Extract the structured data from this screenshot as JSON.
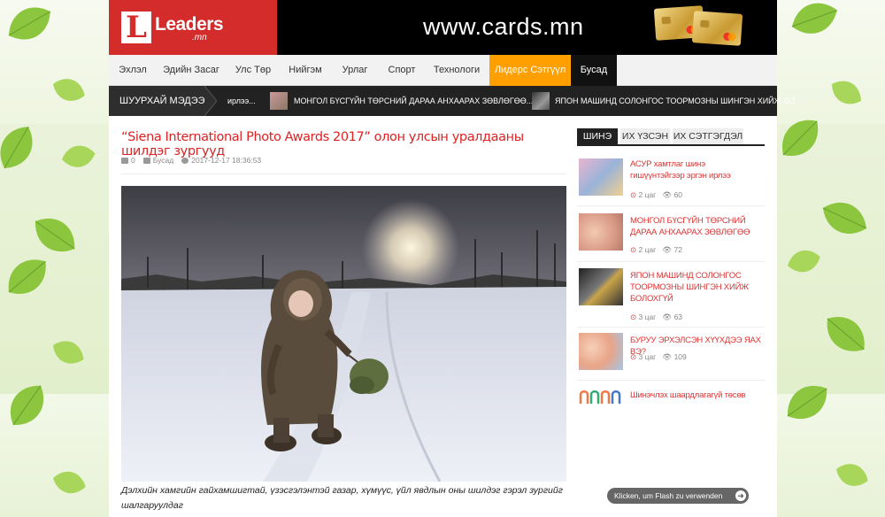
{
  "logo": {
    "mark": "L",
    "name": "Leaders",
    "sub": ".mn"
  },
  "banner": {
    "url": "www.cards.mn"
  },
  "nav": {
    "items": [
      {
        "label": "Эхлэл"
      },
      {
        "label": "Эдийн Засаг"
      },
      {
        "label": "Улс Төр"
      },
      {
        "label": "Нийгэм"
      },
      {
        "label": "Урлаг"
      },
      {
        "label": "Спорт"
      },
      {
        "label": "Технологи"
      },
      {
        "label": "Лидерс Сэтгүүл"
      },
      {
        "label": "Бусад"
      }
    ]
  },
  "ticker": {
    "label": "ШУУРХАЙ МЭДЭЭ",
    "items": [
      {
        "text": "ирлээ..."
      },
      {
        "text": "МОНГОЛ БҮСГҮЙН ТӨРСНИЙ ДАРАА АНХААРАХ ЗӨВЛӨГӨӨ..."
      },
      {
        "text": "ЯПОН МАШИНД СОЛОНГОС ТООРМОЗНЫ ШИНГЭН ХИЙЖ БО"
      }
    ]
  },
  "article": {
    "title": "“Siena International Photo Awards 2017” олон улсын уралдааны шилдэг зургууд",
    "comments": "0",
    "category": "Бусад",
    "datetime": "2017-12-17 18:36:53",
    "caption": "Дэлхийн хамгийн гайхамшигтай, үзэсгэлэнтэй газар, хүмүүс, үйл явдлын оны шилдэг гэрэл зургийг шалгаруулдаг"
  },
  "sidebar": {
    "tabs": [
      {
        "label": "ШИНЭ"
      },
      {
        "label": "ИХ ҮЗСЭН"
      },
      {
        "label": "ИХ СЭТГЭГДЭЛ"
      }
    ],
    "items": [
      {
        "title": "АСУР хамтлаг шинэ гишүүнтэйгээр эргэн ирлээ",
        "time": "2 цаг",
        "views": "60"
      },
      {
        "title": "МОНГОЛ БҮСГҮЙН ТӨРСНИЙ ДАРАА АНХААРАХ ЗӨВЛӨГӨӨ",
        "time": "2 цаг",
        "views": "72"
      },
      {
        "title": "ЯПОН МАШИНД СОЛОНГОС ТООРМОЗНЫ ШИНГЭН ХИЙЖ БОЛОХГҮЙ",
        "time": "3 цаг",
        "views": "63"
      },
      {
        "title": "БУРУУ ЭРХЭЛСЭН ХҮҮХДЭЭ ЯАХ ВЭ?",
        "time": "3 цаг",
        "views": "109"
      },
      {
        "title": "Шинэчлэх шаардлагагүй төсөв",
        "time": "",
        "views": ""
      }
    ]
  },
  "flash": {
    "label": "Klicken, um Flash zu verwenden"
  },
  "colors": {
    "brand_red": "#d42b2b",
    "accent_orange": "#ff9f00",
    "link_red": "#dd3333"
  }
}
